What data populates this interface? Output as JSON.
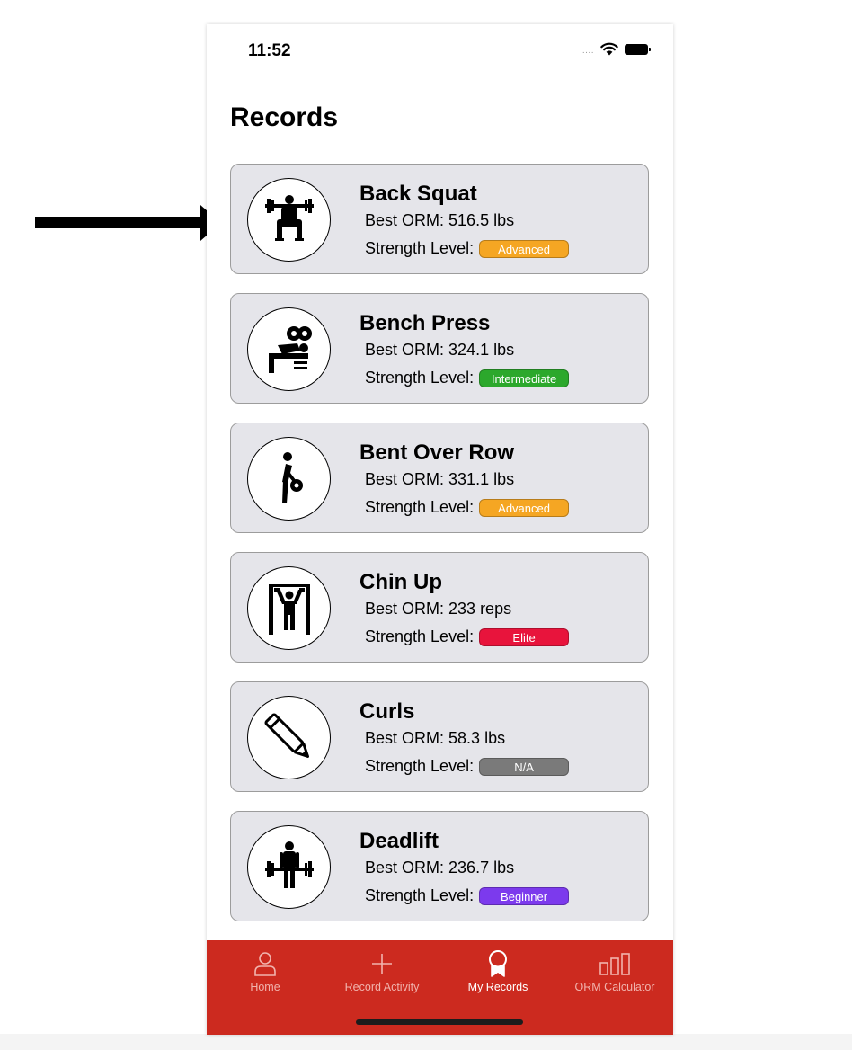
{
  "status_bar": {
    "time": "11:52",
    "signal": "....",
    "icons": [
      "wifi-icon",
      "battery-icon"
    ]
  },
  "page": {
    "title": "Records"
  },
  "records": [
    {
      "name": "Back Squat",
      "orm_label": "Best ORM:",
      "orm_value": "516.5 lbs",
      "level_label": "Strength Level:",
      "level": "Advanced",
      "level_color": "#f5a623",
      "icon": "back-squat-icon"
    },
    {
      "name": "Bench Press",
      "orm_label": "Best ORM:",
      "orm_value": "324.1 lbs",
      "level_label": "Strength Level:",
      "level": "Intermediate",
      "level_color": "#2ca82c",
      "icon": "bench-press-icon"
    },
    {
      "name": "Bent Over Row",
      "orm_label": "Best ORM:",
      "orm_value": "331.1 lbs",
      "level_label": "Strength Level:",
      "level": "Advanced",
      "level_color": "#f5a623",
      "icon": "bent-over-row-icon"
    },
    {
      "name": "Chin Up",
      "orm_label": "Best ORM:",
      "orm_value": "233 reps",
      "level_label": "Strength Level:",
      "level": "Elite",
      "level_color": "#e8143c",
      "icon": "chin-up-icon"
    },
    {
      "name": "Curls",
      "orm_label": "Best ORM:",
      "orm_value": "58.3 lbs",
      "level_label": "Strength Level:",
      "level": "N/A",
      "level_color": "#7a7a7a",
      "icon": "pencil-icon"
    },
    {
      "name": "Deadlift",
      "orm_label": "Best ORM:",
      "orm_value": "236.7 lbs",
      "level_label": "Strength Level:",
      "level": "Beginner",
      "level_color": "#7c3aed",
      "icon": "deadlift-icon"
    }
  ],
  "tab_bar": {
    "background": "#cc2a1f",
    "tabs": [
      {
        "label": "Home",
        "icon": "person-icon",
        "active": false
      },
      {
        "label": "Record Activity",
        "icon": "plus-icon",
        "active": false
      },
      {
        "label": "My Records",
        "icon": "ribbon-icon",
        "active": true
      },
      {
        "label": "ORM Calculator",
        "icon": "bar-chart-icon",
        "active": false
      }
    ]
  },
  "annotation": {
    "icon": "right-arrow-icon",
    "color": "#000000"
  }
}
